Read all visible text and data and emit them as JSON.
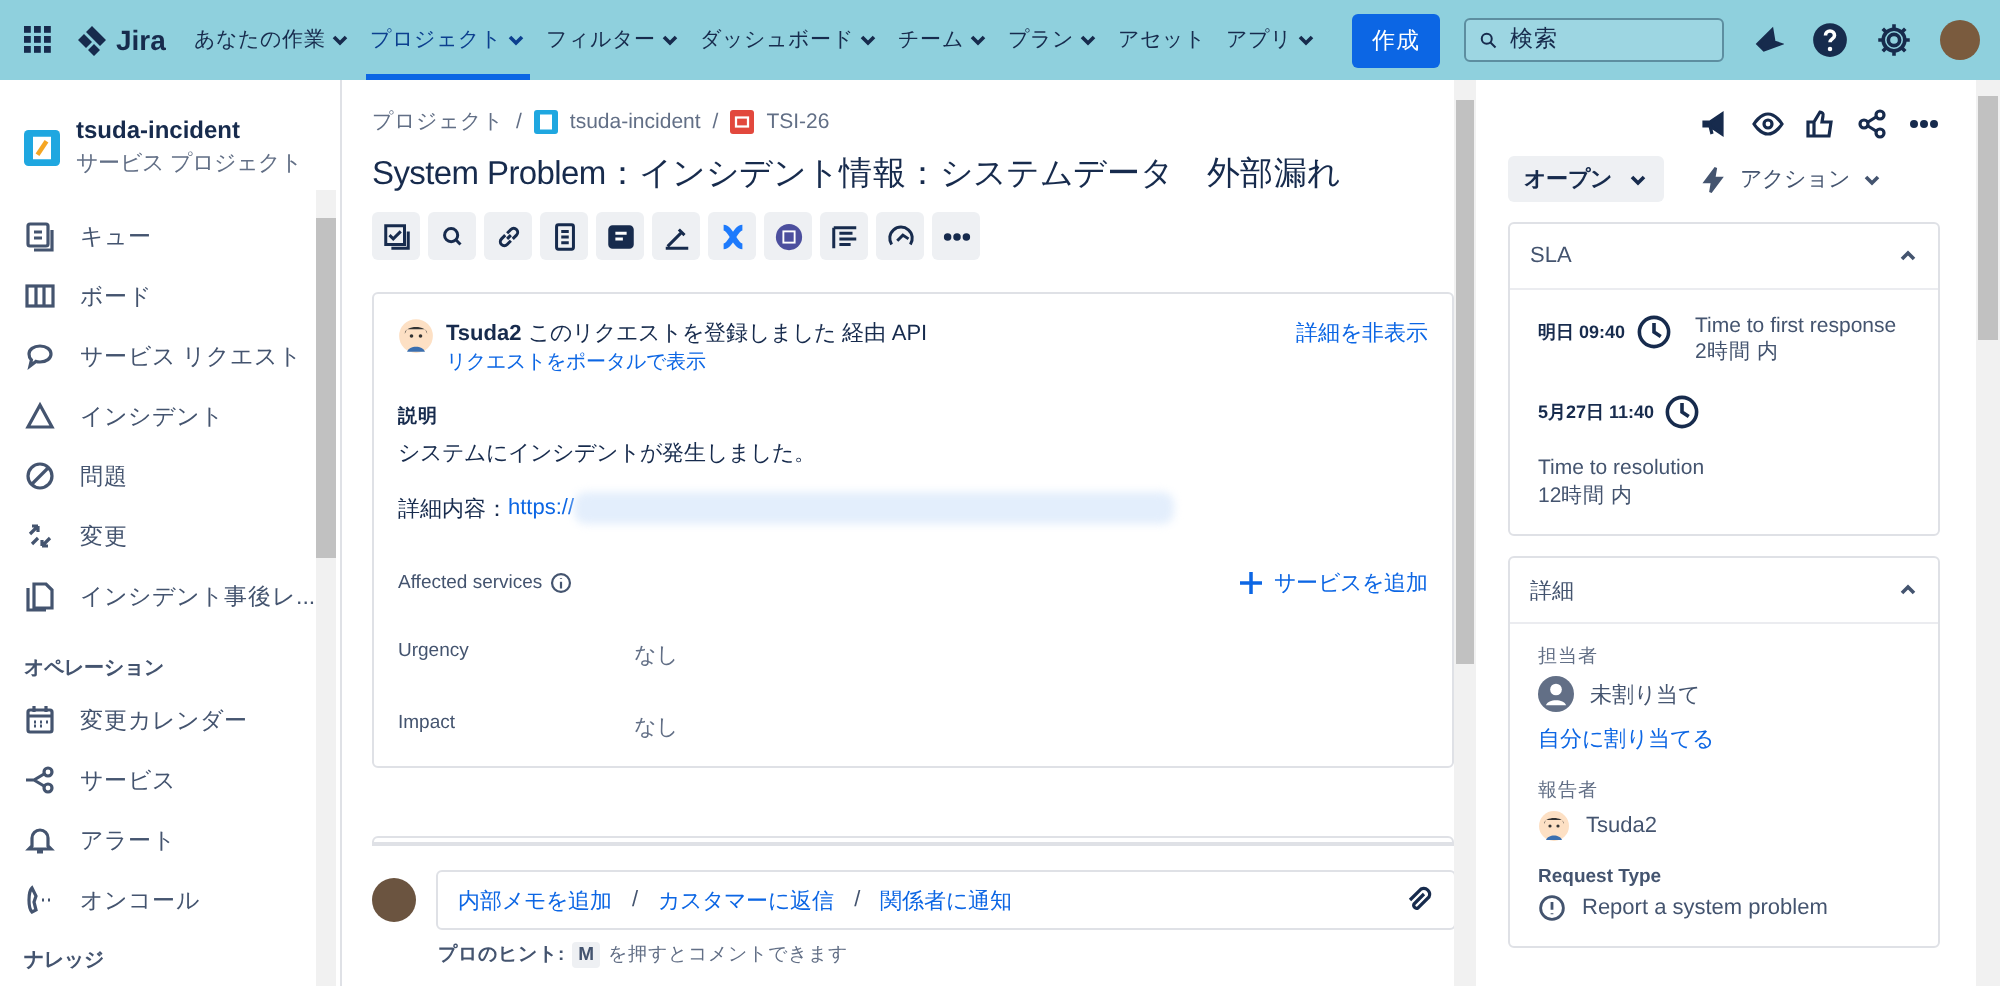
{
  "topnav": {
    "logo": "Jira",
    "menus": [
      {
        "label": "あなたの作業",
        "dropdown": true,
        "selected": false
      },
      {
        "label": "プロジェクト",
        "dropdown": true,
        "selected": true
      },
      {
        "label": "フィルター",
        "dropdown": true,
        "selected": false
      },
      {
        "label": "ダッシュボード",
        "dropdown": true,
        "selected": false
      },
      {
        "label": "チーム",
        "dropdown": true,
        "selected": false
      },
      {
        "label": "プラン",
        "dropdown": true,
        "selected": false
      },
      {
        "label": "アセット",
        "dropdown": false,
        "selected": false
      },
      {
        "label": "アプリ",
        "dropdown": true,
        "selected": false
      }
    ],
    "create_button": "作成",
    "search": {
      "placeholder": "検索"
    }
  },
  "sidebar": {
    "project": {
      "name": "tsuda-incident",
      "type": "サービス プロジェクト"
    },
    "items": [
      {
        "label": "キュー"
      },
      {
        "label": "ボード"
      },
      {
        "label": "サービス リクエスト"
      },
      {
        "label": "インシデント"
      },
      {
        "label": "問題"
      },
      {
        "label": "変更"
      },
      {
        "label": "インシデント事後レ..."
      }
    ],
    "sections": [
      {
        "heading": "オペレーション",
        "items": [
          {
            "label": "変更カレンダー"
          },
          {
            "label": "サービス"
          },
          {
            "label": "アラート"
          },
          {
            "label": "オンコール"
          }
        ]
      },
      {
        "heading": "ナレッジ"
      }
    ]
  },
  "issue": {
    "breadcrumb": [
      "プロジェクト",
      "tsuda-incident",
      "TSI-26"
    ],
    "breadcrumb_separator": "/",
    "title": "System Problem：インシデント情報：システムデータ　外部漏れ",
    "request": {
      "author": "Tsuda2",
      "text": "このリクエストを登録しました 経由 API",
      "portal_link": "リクエストをポータルで表示",
      "toggle": "詳細を非表示"
    },
    "description": {
      "label": "説明",
      "lines": [
        "システムにインシデントが発生しました。"
      ],
      "detail_label": "詳細内容：",
      "detail_link": "https://"
    },
    "affected_services": {
      "label": "Affected services",
      "add": "サービスを追加"
    },
    "fields": [
      {
        "label": "Urgency",
        "value": "なし"
      },
      {
        "label": "Impact",
        "value": "なし"
      }
    ],
    "comment": {
      "separator": "/",
      "actions": [
        "内部メモを追加",
        "カスタマーに返信",
        "関係者に通知"
      ],
      "hint_label": "プロのヒント:",
      "hint_key": "M",
      "hint_text": "を押すとコメントできます"
    }
  },
  "side_panel": {
    "status": "オープン",
    "actions": "アクション",
    "sla": {
      "title": "SLA",
      "expanded": true,
      "items": [
        {
          "time": "明日 09:40",
          "name": "Time to first response",
          "remaining": "2時間 内"
        },
        {
          "time": "5月27日 11:40",
          "name": "Time to resolution",
          "remaining": "12時間 内"
        }
      ]
    },
    "details": {
      "title": "詳細",
      "expanded": true,
      "assignee_label": "担当者",
      "assignee": "未割り当て",
      "assign_me": "自分に割り当てる",
      "reporter_label": "報告者",
      "reporter": "Tsuda2",
      "request_type_label": "Request Type",
      "request_type": "Report a system problem"
    }
  }
}
